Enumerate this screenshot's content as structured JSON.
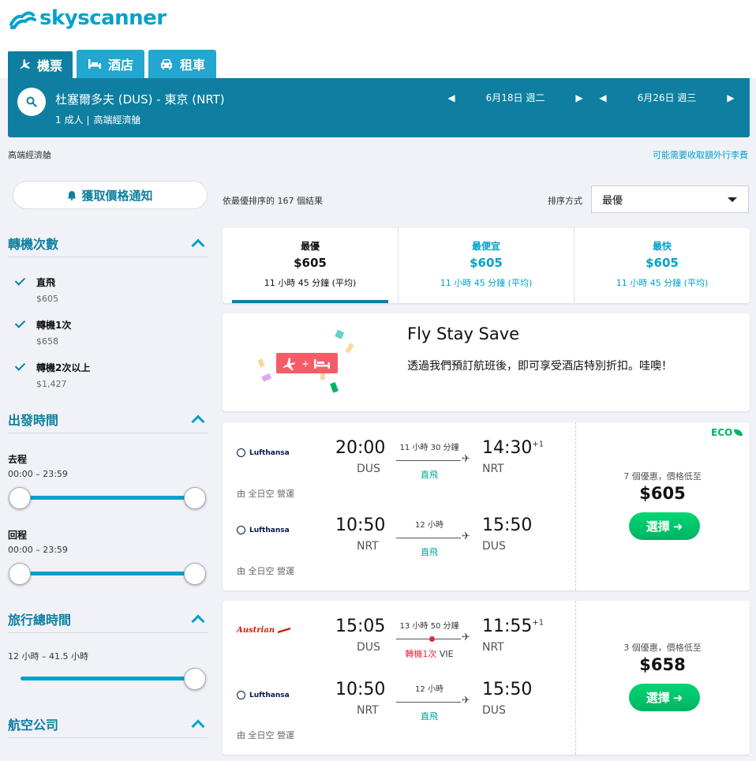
{
  "brand": {
    "name": "skyscanner"
  },
  "tabs": [
    {
      "label": "機票",
      "icon": "plane-icon"
    },
    {
      "label": "酒店",
      "icon": "bed-icon"
    },
    {
      "label": "租車",
      "icon": "car-icon"
    }
  ],
  "search": {
    "route": "杜塞爾多夫 (DUS) - 東京 (NRT)",
    "passengers": "1 成人",
    "cabin": "高端經濟艙",
    "outbound_date": "6月18日 週二",
    "return_date": "6月26日 週三"
  },
  "subheader": {
    "cabin": "高端經濟艙",
    "baggage_note": "可能需要收取額外行李費"
  },
  "sidebar": {
    "price_alert": "獲取價格通知",
    "stops": {
      "title": "轉機次數",
      "options": [
        {
          "label": "直飛",
          "price": "$605"
        },
        {
          "label": "轉機1次",
          "price": "$658"
        },
        {
          "label": "轉機2次以上",
          "price": "$1,427"
        }
      ]
    },
    "departure": {
      "title": "出發時間",
      "outbound_label": "去程",
      "outbound_range": "00:00 – 23:59",
      "return_label": "回程",
      "return_range": "00:00 – 23:59"
    },
    "duration": {
      "title": "旅行總時間",
      "range": "12 小時 – 41.5 小時"
    },
    "airlines": {
      "title": "航空公司"
    }
  },
  "results": {
    "count_text": "依最優排序的 167 個結果",
    "sort_label": "排序方式",
    "sort_value": "最優"
  },
  "sort_tabs": [
    {
      "label": "最優",
      "price": "$605",
      "duration": "11 小時 45 分鐘 (平均)"
    },
    {
      "label": "最便宜",
      "price": "$605",
      "duration": "11 小時 45 分鐘 (平均)"
    },
    {
      "label": "最快",
      "price": "$605",
      "duration": "11 小時 45 分鐘 (平均)"
    }
  ],
  "promo": {
    "title": "Fly Stay Save",
    "description": "透過我們預訂航班後，即可享受酒店特別折扣。哇噢！",
    "badge_plus": "+"
  },
  "flights": [
    {
      "eco_label": "ECO",
      "deals": "7 個優惠，價格低至",
      "price": "$605",
      "select_label": "選擇",
      "legs": [
        {
          "airline": "Lufthansa",
          "dep_time": "20:00",
          "dep_code": "DUS",
          "duration": "11 小時 30 分鐘",
          "stops": "直飛",
          "arr_time": "14:30",
          "arr_plus": "+1",
          "arr_code": "NRT",
          "operated": "由 全日空 營運"
        },
        {
          "airline": "Lufthansa",
          "dep_time": "10:50",
          "dep_code": "NRT",
          "duration": "12 小時",
          "stops": "直飛",
          "arr_time": "15:50",
          "arr_code": "DUS",
          "operated": "由 全日空 營運"
        }
      ]
    },
    {
      "deals": "3 個優惠，價格低至",
      "price": "$658",
      "select_label": "選擇",
      "legs": [
        {
          "airline": "Austrian",
          "dep_time": "15:05",
          "dep_code": "DUS",
          "duration": "13 小時 50 分鐘",
          "stops": "轉機1次",
          "via": "VIE",
          "arr_time": "11:55",
          "arr_plus": "+1",
          "arr_code": "NRT"
        },
        {
          "airline": "Lufthansa",
          "dep_time": "10:50",
          "dep_code": "NRT",
          "duration": "12 小時",
          "stops": "直飛",
          "arr_time": "15:50",
          "arr_code": "DUS",
          "operated": "由 全日空 營運"
        }
      ]
    }
  ],
  "colors": {
    "brand": "#00a2cc",
    "header_bar": "#0e7fa0",
    "select_button": "#00d775",
    "stop_red": "#e02a3c",
    "direct_green": "#00a698"
  }
}
